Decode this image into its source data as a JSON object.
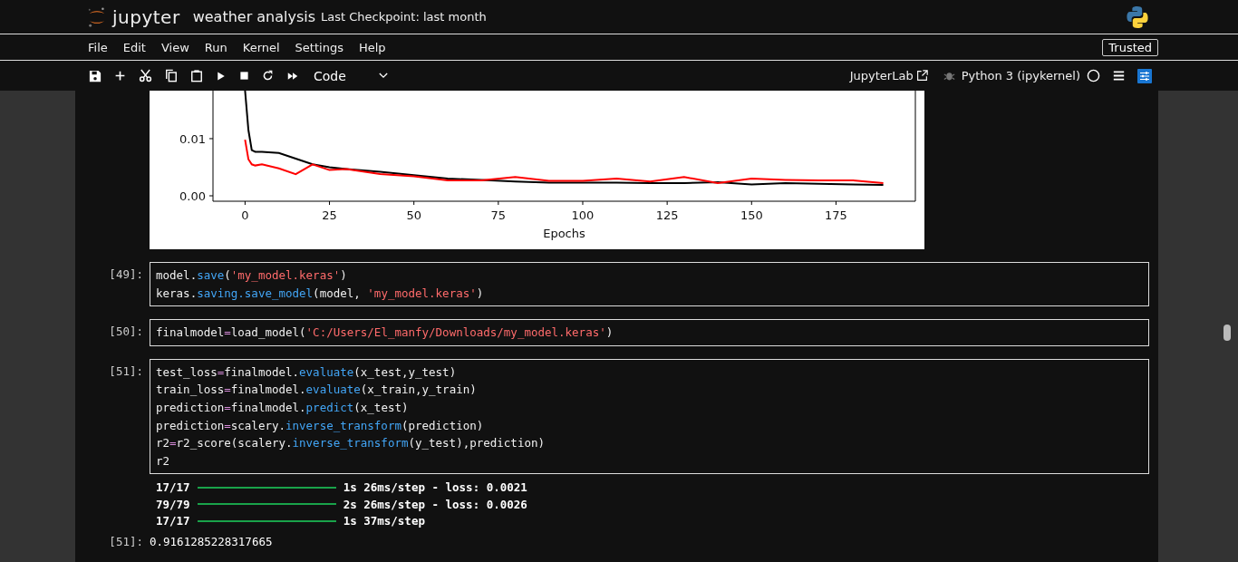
{
  "header": {
    "app_name": "jupyter",
    "notebook_title": "weather analysis",
    "checkpoint": "Last Checkpoint: last month"
  },
  "menu": [
    "File",
    "Edit",
    "View",
    "Run",
    "Kernel",
    "Settings",
    "Help"
  ],
  "trusted": "Trusted",
  "toolbar": {
    "cell_type": "Code",
    "jupyterlab_link": "JupyterLab",
    "kernel": "Python 3 (ipykernel)"
  },
  "chart": {
    "chart_data": {
      "type": "line",
      "xlabel": "Epochs",
      "x": [
        0,
        1,
        2,
        3,
        5,
        10,
        15,
        20,
        25,
        30,
        40,
        50,
        60,
        70,
        80,
        90,
        100,
        110,
        120,
        130,
        140,
        150,
        160,
        170,
        180,
        189
      ],
      "series": [
        {
          "color": "#000000",
          "values": [
            0.0184,
            0.0115,
            0.008,
            0.0077,
            0.0077,
            0.0075,
            0.0065,
            0.0055,
            0.005,
            0.0047,
            0.0042,
            0.0036,
            0.003,
            0.0028,
            0.0025,
            0.0023,
            0.0023,
            0.0023,
            0.0022,
            0.0022,
            0.0024,
            0.002,
            0.0022,
            0.0021,
            0.002,
            0.0019
          ]
        },
        {
          "color": "#ff0000",
          "values": [
            0.0098,
            0.0064,
            0.0055,
            0.0053,
            0.0055,
            0.0048,
            0.0038,
            0.0055,
            0.0045,
            0.0047,
            0.0038,
            0.0034,
            0.0027,
            0.0027,
            0.0033,
            0.0026,
            0.0026,
            0.003,
            0.0025,
            0.0033,
            0.0022,
            0.003,
            0.0028,
            0.0027,
            0.0027,
            0.0022
          ]
        }
      ],
      "xlim": [
        -9.5,
        198.5
      ],
      "ylim": [
        -0.00095,
        0.0184
      ],
      "xticks": [
        0,
        25,
        50,
        75,
        100,
        125,
        150,
        175
      ],
      "yticks": [
        {
          "value": 0,
          "label": "0.00"
        },
        {
          "value": 0.01,
          "label": "0.01"
        }
      ]
    }
  },
  "cells": [
    {
      "prompt": "[49]:",
      "lines": [
        [
          {
            "text": "model.",
            "kind": "name"
          },
          {
            "text": "save",
            "kind": "method"
          },
          {
            "text": "(",
            "kind": "name"
          },
          {
            "text": "'my_model.keras'",
            "kind": "string"
          },
          {
            "text": ")",
            "kind": "name"
          }
        ],
        [
          {
            "text": "keras.",
            "kind": "name"
          },
          {
            "text": "saving",
            "kind": "method"
          },
          {
            "text": ".save_model",
            "kind": "method"
          },
          {
            "text": "(model, ",
            "kind": "name"
          },
          {
            "text": "'my_model.keras'",
            "kind": "string"
          },
          {
            "text": ")",
            "kind": "name"
          }
        ]
      ]
    },
    {
      "prompt": "[50]:",
      "lines": [
        [
          {
            "text": "finalmodel",
            "kind": "name"
          },
          {
            "text": "=",
            "kind": "op"
          },
          {
            "text": "load_model(",
            "kind": "name"
          },
          {
            "text": "'C:/Users/El_manfy/Downloads/my_model.keras'",
            "kind": "string"
          },
          {
            "text": ")",
            "kind": "name"
          }
        ]
      ]
    },
    {
      "prompt": "[51]:",
      "lines": [
        [
          {
            "text": "test_loss",
            "kind": "name"
          },
          {
            "text": "=",
            "kind": "op"
          },
          {
            "text": "finalmodel.",
            "kind": "name"
          },
          {
            "text": "evaluate",
            "kind": "method"
          },
          {
            "text": "(x_test,y_test)",
            "kind": "name"
          }
        ],
        [
          {
            "text": "train_loss",
            "kind": "name"
          },
          {
            "text": "=",
            "kind": "op"
          },
          {
            "text": "finalmodel.",
            "kind": "name"
          },
          {
            "text": "evaluate",
            "kind": "method"
          },
          {
            "text": "(x_train,y_train)",
            "kind": "name"
          }
        ],
        [
          {
            "text": "prediction",
            "kind": "name"
          },
          {
            "text": "=",
            "kind": "op"
          },
          {
            "text": "finalmodel.",
            "kind": "name"
          },
          {
            "text": "predict",
            "kind": "method"
          },
          {
            "text": "(x_test)",
            "kind": "name"
          }
        ],
        [
          {
            "text": "prediction",
            "kind": "name"
          },
          {
            "text": "=",
            "kind": "op"
          },
          {
            "text": "scalery.",
            "kind": "name"
          },
          {
            "text": "inverse_transform",
            "kind": "method"
          },
          {
            "text": "(prediction)",
            "kind": "name"
          }
        ],
        [
          {
            "text": "r2",
            "kind": "name"
          },
          {
            "text": "=",
            "kind": "op"
          },
          {
            "text": "r2_score(scalery.",
            "kind": "name"
          },
          {
            "text": "inverse_transform",
            "kind": "method"
          },
          {
            "text": "(y_test),prediction)",
            "kind": "name"
          }
        ],
        [
          {
            "text": "r2",
            "kind": "name"
          }
        ]
      ],
      "progress": [
        {
          "count": "17/17",
          "level": 1,
          "info": "1s 26ms/step - loss: 0.0021"
        },
        {
          "count": "79/79",
          "level": 1,
          "info": "2s 26ms/step - loss: 0.0026"
        },
        {
          "count": "17/17",
          "level": 1,
          "info": "1s 37ms/step"
        }
      ],
      "result": {
        "prompt": "[51]:",
        "text": "0.9161285228317665"
      }
    }
  ]
}
